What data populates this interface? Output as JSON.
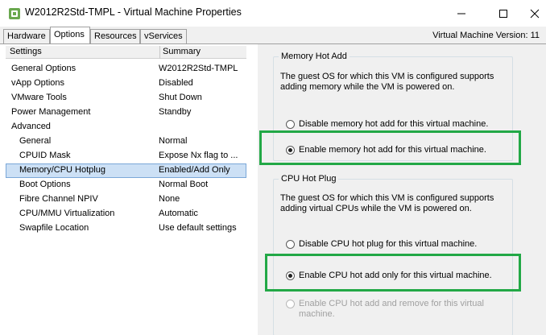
{
  "window": {
    "title": "W2012R2Std-TMPL - Virtual Machine Properties",
    "version_text": "Virtual Machine Version: 11"
  },
  "tabs": [
    {
      "label": "Hardware"
    },
    {
      "label": "Options"
    },
    {
      "label": "Resources"
    },
    {
      "label": "vServices"
    }
  ],
  "active_tab": "Options",
  "list": {
    "columns": [
      "Settings",
      "Summary"
    ],
    "rows": [
      {
        "name": "General Options",
        "summary": "W2012R2Std-TMPL"
      },
      {
        "name": "vApp Options",
        "summary": "Disabled"
      },
      {
        "name": "VMware Tools",
        "summary": "Shut Down"
      },
      {
        "name": "Power Management",
        "summary": "Standby"
      },
      {
        "name": "Advanced",
        "summary": ""
      },
      {
        "name": "General",
        "summary": "Normal"
      },
      {
        "name": "CPUID Mask",
        "summary": "Expose Nx flag to ..."
      },
      {
        "name": "Memory/CPU Hotplug",
        "summary": "Enabled/Add Only"
      },
      {
        "name": "Boot Options",
        "summary": "Normal Boot"
      },
      {
        "name": "Fibre Channel NPIV",
        "summary": "None"
      },
      {
        "name": "CPU/MMU Virtualization",
        "summary": "Automatic"
      },
      {
        "name": "Swapfile Location",
        "summary": "Use default settings"
      }
    ],
    "selected": "Memory/CPU Hotplug"
  },
  "memory_hot_add": {
    "title": "Memory Hot Add",
    "description": "The guest OS for which this VM is configured supports adding memory while the VM is powered on.",
    "options": [
      {
        "label": "Disable memory hot add for this virtual machine.",
        "checked": false,
        "disabled": false
      },
      {
        "label": "Enable memory hot add for this virtual machine.",
        "checked": true,
        "disabled": false
      }
    ]
  },
  "cpu_hot_plug": {
    "title": "CPU Hot Plug",
    "description": "The guest OS for which this VM is configured supports adding virtual CPUs while the VM is powered on.",
    "options": [
      {
        "label": "Disable CPU hot plug for this virtual machine.",
        "checked": false,
        "disabled": false
      },
      {
        "label": "Enable CPU hot add only for this virtual machine.",
        "checked": true,
        "disabled": false
      },
      {
        "label": "Enable CPU hot add and remove for this virtual machine.",
        "checked": false,
        "disabled": true
      }
    ]
  },
  "colors": {
    "highlight": "#22a846",
    "selection": "#cce0f5"
  }
}
